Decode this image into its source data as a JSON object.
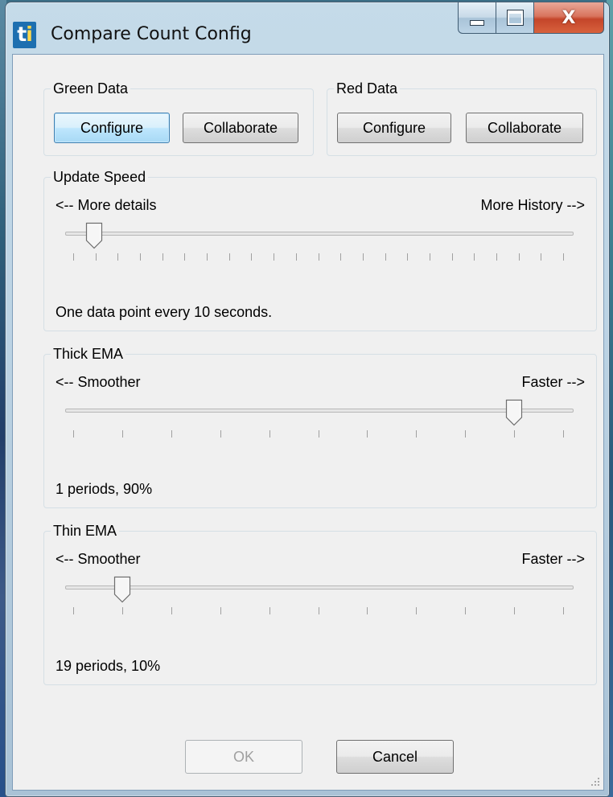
{
  "window": {
    "title": "Compare Count Config",
    "icon_text": "ti"
  },
  "caption_buttons": {
    "minimize": "minimize-icon",
    "maximize": "maximize-icon",
    "close": "X"
  },
  "green_data": {
    "title": "Green Data",
    "configure": "Configure",
    "collaborate": "Collaborate"
  },
  "red_data": {
    "title": "Red Data",
    "configure": "Configure",
    "collaborate": "Collaborate"
  },
  "update_speed": {
    "title": "Update Speed",
    "left_label": "<-- More details",
    "right_label": "More History -->",
    "status": "One data point every 10  seconds.",
    "slider_value": 1,
    "tick_count": 23
  },
  "thick_ema": {
    "title": "Thick EMA",
    "left_label": "<-- Smoother",
    "right_label": "Faster -->",
    "status": "1 periods, 90%",
    "slider_value": 9,
    "tick_count": 11
  },
  "thin_ema": {
    "title": "Thin EMA",
    "left_label": "<-- Smoother",
    "right_label": "Faster -->",
    "status": "19 periods, 10%",
    "slider_value": 1,
    "tick_count": 11
  },
  "footer": {
    "ok": "OK",
    "cancel": "Cancel",
    "ok_enabled": false
  },
  "colors": {
    "client_bg": "#f0f0f0",
    "frame": "#bcd3e4",
    "close_button": "#c4452a"
  }
}
